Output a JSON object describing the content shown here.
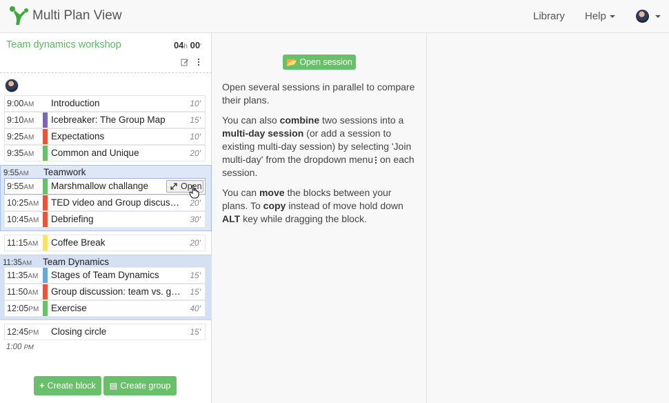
{
  "header": {
    "app_title": "Multi Plan View",
    "nav": {
      "library": "Library",
      "help": "Help"
    }
  },
  "session": {
    "title": "Team dynamics workshop",
    "duration_hours": "04",
    "duration_h_unit": "h",
    "duration_minutes": "00",
    "duration_m_unit": "'"
  },
  "blocks": [
    {
      "time": "9:00",
      "ampm": "AM",
      "name": "Introduction",
      "dur": "10'",
      "color": "#ffffff"
    },
    {
      "time": "9:10",
      "ampm": "AM",
      "name": "Icebreaker: The Group Map",
      "dur": "15'",
      "color": "#7b68b0"
    },
    {
      "time": "9:25",
      "ampm": "AM",
      "name": "Expectations",
      "dur": "10'",
      "color": "#e4573d"
    },
    {
      "time": "9:35",
      "ampm": "AM",
      "name": "Common and Unique",
      "dur": "20'",
      "color": "#6abf6a"
    }
  ],
  "group_teamwork": {
    "time": "9:55",
    "ampm": "AM",
    "name": "Teamwork",
    "blocks": [
      {
        "time": "9:55",
        "ampm": "AM",
        "name": "Marshmallow challange",
        "dur": "",
        "color": "#6abf6a"
      },
      {
        "time": "10:25",
        "ampm": "AM",
        "name": "TED video and Group discussion",
        "dur": "20'",
        "color": "#e4573d"
      },
      {
        "time": "10:45",
        "ampm": "AM",
        "name": "Debriefing",
        "dur": "30'",
        "color": "#e4573d"
      }
    ],
    "open_label": "Open"
  },
  "coffee": {
    "time": "11:15",
    "ampm": "AM",
    "name": "Coffee Break",
    "dur": "20'",
    "color": "#f7e36a"
  },
  "group_dynamics": {
    "time": "11:35",
    "ampm": "AM",
    "name": "Team Dynamics",
    "blocks": [
      {
        "time": "11:35",
        "ampm": "AM",
        "name": "Stages of Team Dynamics",
        "dur": "15'",
        "color": "#6aa8d8"
      },
      {
        "time": "11:50",
        "ampm": "AM",
        "name": "Group discussion: team vs. group",
        "dur": "15'",
        "color": "#e4573d"
      },
      {
        "time": "12:05",
        "ampm": "PM",
        "name": "Exercise",
        "dur": "40'",
        "color": "#6abf6a"
      }
    ]
  },
  "closing": {
    "time": "12:45",
    "ampm": "PM",
    "name": "Closing circle",
    "dur": "15'",
    "color": "#ffffff"
  },
  "end_time": {
    "time": "1:00",
    "ampm": "PM"
  },
  "buttons": {
    "create_block": "Create block",
    "create_group": "Create group",
    "open_session": "Open session"
  },
  "info": {
    "p1": "Open several sessions in parallel to compare their plans.",
    "p2_a": "You can also ",
    "p2_b": "combine",
    "p2_c": " two sessions into a ",
    "p2_d": "multi-day session",
    "p2_e": " (or add a session to existing multi-day session) by selecting 'Join multi-day' from the dropdown menu",
    "p2_f": " on each session.",
    "p3_a": "You can ",
    "p3_b": "move",
    "p3_c": " the blocks between your plans. To ",
    "p3_d": "copy",
    "p3_e": " instead of move hold down ",
    "p3_f": "ALT",
    "p3_g": " key while dragging the block."
  },
  "colors": {
    "accent": "#5cb85c",
    "group_bg": "#d5e0f2"
  }
}
